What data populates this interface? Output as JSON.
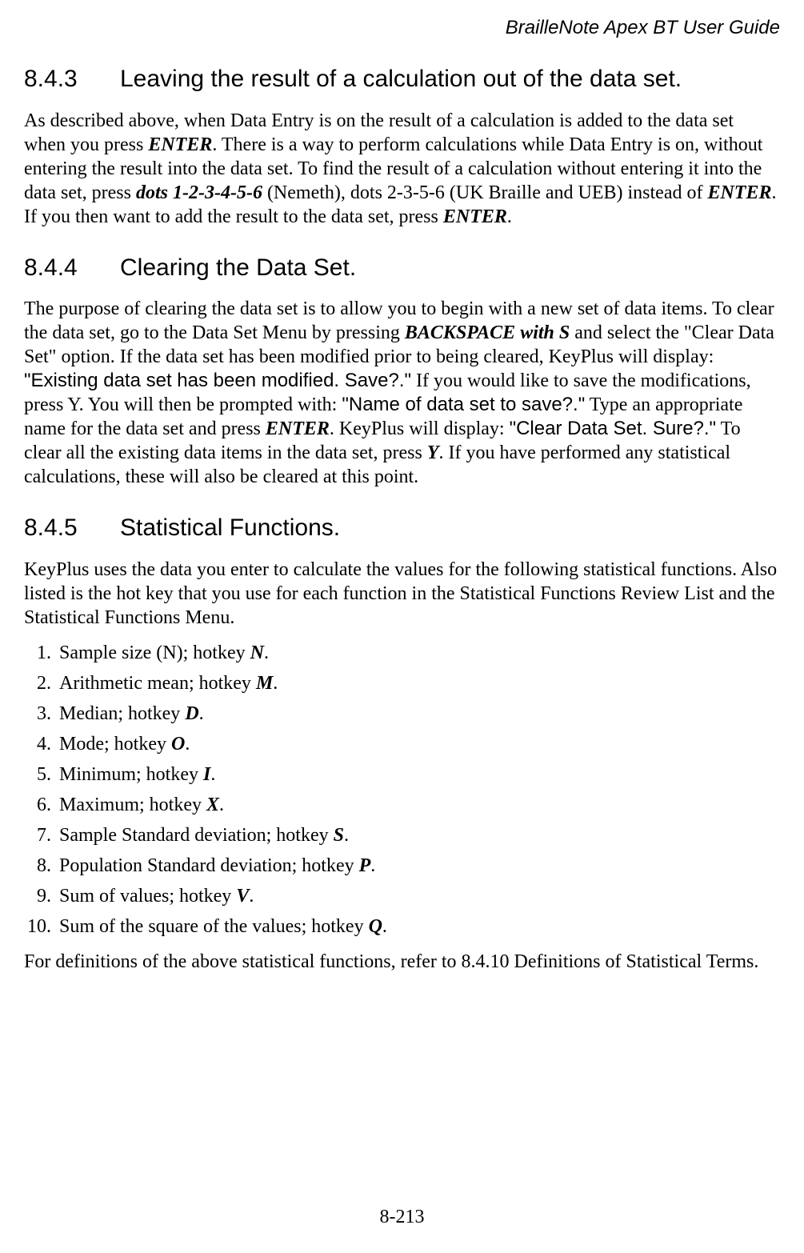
{
  "header": {
    "title": "BrailleNote Apex BT User Guide"
  },
  "sections": {
    "s843": {
      "num": "8.4.3",
      "title": "Leaving the result of a calculation out of the data set.",
      "p1_a": "As described above, when Data Entry is on the result of a calculation is added to the data set when you press ",
      "p1_enter1": "ENTER",
      "p1_b": ". There is a way to perform calculations while Data Entry is on, without entering the result into the data set. To find the result of a calculation without entering it into the data set, press ",
      "p1_dots": "dots 1-2-3-4-5-6",
      "p1_c": " (Nemeth), dots 2-3-5-6 (UK Braille and UEB) instead of ",
      "p1_enter2": "ENTER",
      "p1_d": ". If you then want to add the result to the data set, press ",
      "p1_enter3": "ENTER",
      "p1_e": "."
    },
    "s844": {
      "num": "8.4.4",
      "title": "Clearing the Data Set.",
      "p1_a": "The purpose of clearing the data set is to allow you to begin with a new set of data items. To clear the data set, go to the Data Set Menu by pressing ",
      "p1_bsS": "BACKSPACE with S",
      "p1_b": " and select the \"Clear Data Set\" option. If the data set has been modified prior to being cleared, KeyPlus will display: ",
      "p1_prompt1": "\"Existing data set has been modified. Save?.\"",
      "p1_c": " If you would like to save the modifications, press Y. You will then be prompted with: ",
      "p1_prompt2": "\"Name of data set to save?.\"",
      "p1_d": " Type an appropriate name for the data set and press ",
      "p1_enter": "ENTER",
      "p1_e": ". KeyPlus will display: ",
      "p1_prompt3": "\"Clear Data Set. Sure?.\"",
      "p1_f": " To clear all the existing data items in the data set, press ",
      "p1_Y": "Y",
      "p1_g": ". If you have performed any statistical calculations, these will also be cleared at this point."
    },
    "s845": {
      "num": "8.4.5",
      "title": "Statistical Functions.",
      "intro": "KeyPlus uses the data you enter to calculate the values for the following statistical functions. Also listed is the hot key that you use for each function in the Statistical Functions Review List and the Statistical Functions Menu.",
      "items": [
        {
          "text": "Sample size (N); hotkey ",
          "hk": "N",
          "tail": "."
        },
        {
          "text": "Arithmetic mean; hotkey ",
          "hk": "M",
          "tail": "."
        },
        {
          "text": "Median; hotkey ",
          "hk": "D",
          "tail": "."
        },
        {
          "text": "Mode; hotkey ",
          "hk": "O",
          "tail": "."
        },
        {
          "text": "Minimum; hotkey ",
          "hk": "I",
          "tail": "."
        },
        {
          "text": "Maximum; hotkey ",
          "hk": "X",
          "tail": "."
        },
        {
          "text": "Sample Standard deviation; hotkey ",
          "hk": "S",
          "tail": "."
        },
        {
          "text": "Population Standard deviation; hotkey ",
          "hk": "P",
          "tail": "."
        },
        {
          "text": "Sum of values; hotkey ",
          "hk": "V",
          "tail": "."
        },
        {
          "text": "Sum of the square of the values; hotkey ",
          "hk": "Q",
          "tail": "."
        }
      ],
      "closing": "For definitions of the above statistical functions, refer to 8.4.10 Definitions of Statistical Terms."
    }
  },
  "footer": {
    "page": "8-213"
  }
}
